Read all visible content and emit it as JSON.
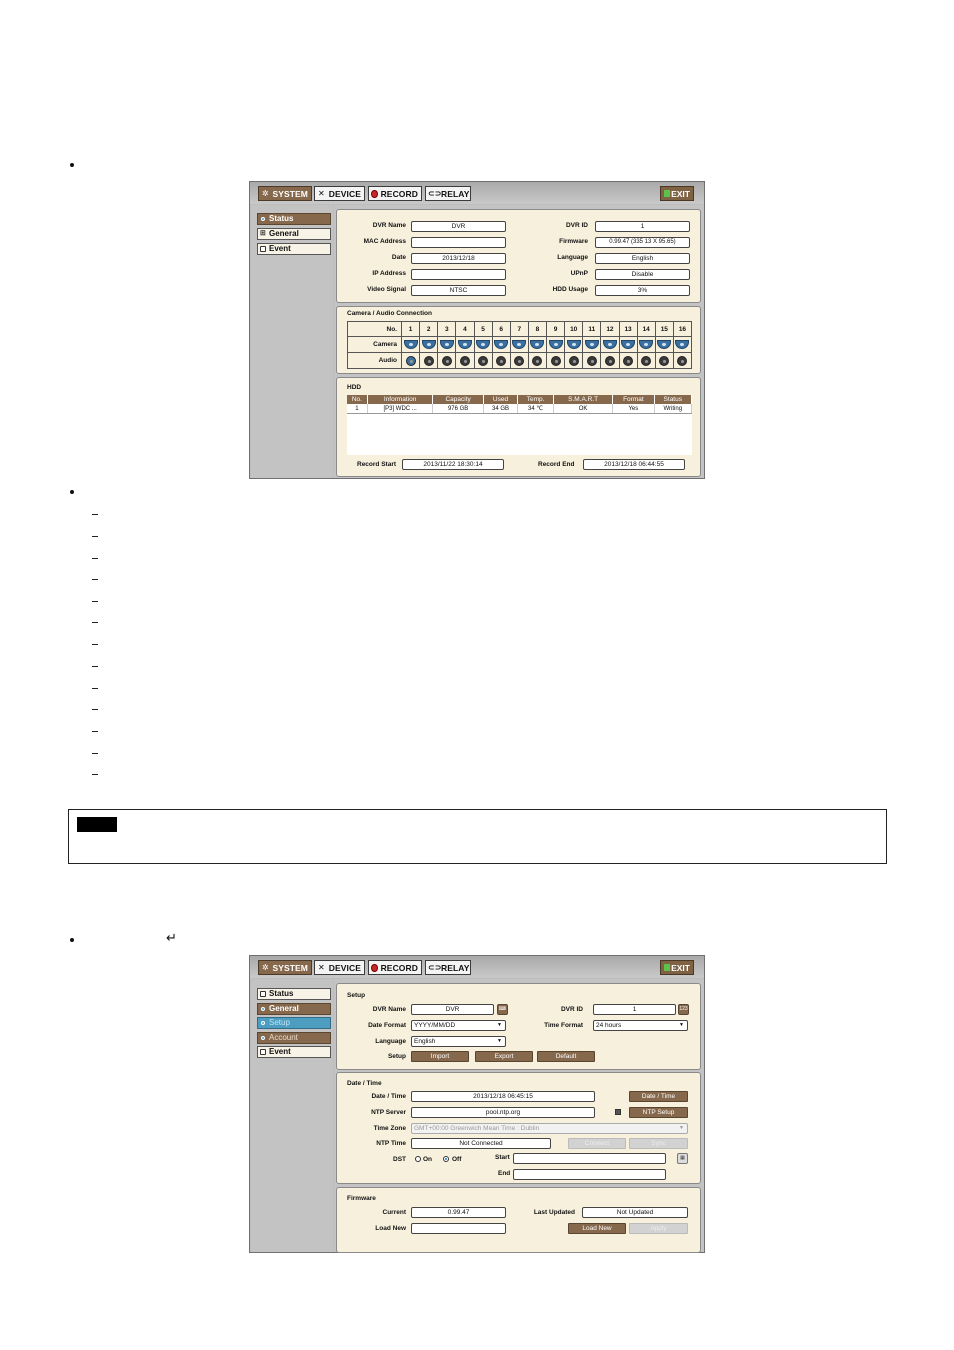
{
  "doc": {
    "return_symbol": "↵"
  },
  "window1": {
    "tabs": [
      {
        "label": "SYSTEM",
        "icon": "gear-icon"
      },
      {
        "label": "DEVICE",
        "icon": "tools-icon"
      },
      {
        "label": "RECORD",
        "icon": "record-icon"
      },
      {
        "label": "RELAY",
        "icon": "relay-icon"
      }
    ],
    "exit_label": "EXIT",
    "sidebar": [
      "Status",
      "General",
      "Event"
    ],
    "info": {
      "dvr_name_label": "DVR Name",
      "dvr_name": "DVR",
      "mac_label": "MAC Address",
      "mac": "",
      "date_label": "Date",
      "date": "2013/12/18",
      "ip_label": "IP Address",
      "ip": "",
      "video_label": "Video Signal",
      "video": "NTSC",
      "dvr_id_label": "DVR ID",
      "dvr_id": "1",
      "firmware_label": "Firmware",
      "firmware": "0.99.47 (335 13 X 95.65)",
      "language_label": "Language",
      "language": "English",
      "upnp_label": "UPnP",
      "upnp": "Disable",
      "hdd_usage_label": "HDD Usage",
      "hdd_usage": "3%"
    },
    "connection": {
      "title": "Camera / Audio Connection",
      "row_no": "No.",
      "row_camera": "Camera",
      "row_audio": "Audio",
      "numbers": [
        "1",
        "2",
        "3",
        "4",
        "5",
        "6",
        "7",
        "8",
        "9",
        "10",
        "11",
        "12",
        "13",
        "14",
        "15",
        "16"
      ]
    },
    "hdd": {
      "title": "HDD",
      "headers": [
        "No.",
        "Information",
        "Capacity",
        "Used",
        "Temp.",
        "S.M.A.R.T",
        "Format",
        "Status"
      ],
      "rows": [
        [
          "1",
          "[P3] WDC ...",
          "976 GB",
          "34 GB",
          "34 ℃",
          "OK",
          "Yes",
          "Writing"
        ]
      ],
      "record_start_label": "Record Start",
      "record_start": "2013/11/22 18:30:14",
      "record_end_label": "Record End",
      "record_end": "2013/12/18 06:44:55"
    }
  },
  "window2": {
    "tabs": [
      {
        "label": "SYSTEM",
        "icon": "gear-icon"
      },
      {
        "label": "DEVICE",
        "icon": "tools-icon"
      },
      {
        "label": "RECORD",
        "icon": "record-icon"
      },
      {
        "label": "RELAY",
        "icon": "relay-icon"
      }
    ],
    "exit_label": "EXIT",
    "sidebar": [
      "Status",
      "General",
      "Setup",
      "Account",
      "Event"
    ],
    "setup": {
      "title": "Setup",
      "dvr_name_label": "DVR Name",
      "dvr_name": "DVR",
      "dvr_id_label": "DVR ID",
      "dvr_id": "1",
      "date_format_label": "Date Format",
      "date_format": "YYYY/MM/DD",
      "time_format_label": "Time Format",
      "time_format": "24 hours",
      "language_label": "Language",
      "language": "English",
      "setup_label": "Setup",
      "import_btn": "Import",
      "export_btn": "Export",
      "default_btn": "Default",
      "keyboard_badge": "123"
    },
    "datetime": {
      "title": "Date / Time",
      "dt_label": "Date / Time",
      "dt_value": "2013/12/18  06:45:15",
      "dt_btn": "Date / Time",
      "ntp_server_label": "NTP Server",
      "ntp_server": "pool.ntp.org",
      "ntp_setup_btn": "NTP Setup",
      "tz_label": "Time Zone",
      "tz_value": "GMT+00:00 Greenwich Mean Time : Dublin",
      "ntp_time_label": "NTP Time",
      "ntp_time": "Not Connected",
      "connect_btn": "Connect",
      "sync_btn": "Sync",
      "dst_label": "DST",
      "dst_on": "On",
      "dst_off": "Off",
      "start_label": "Start",
      "end_label": "End",
      "start": "",
      "end": ""
    },
    "firmware": {
      "title": "Firmware",
      "current_label": "Current",
      "current": "0.99.47",
      "last_updated_label": "Last Updated",
      "last_updated": "Not Updated",
      "load_new_label": "Load New",
      "load_new": "",
      "load_new_btn": "Load New",
      "apply_btn": "Apply"
    }
  }
}
